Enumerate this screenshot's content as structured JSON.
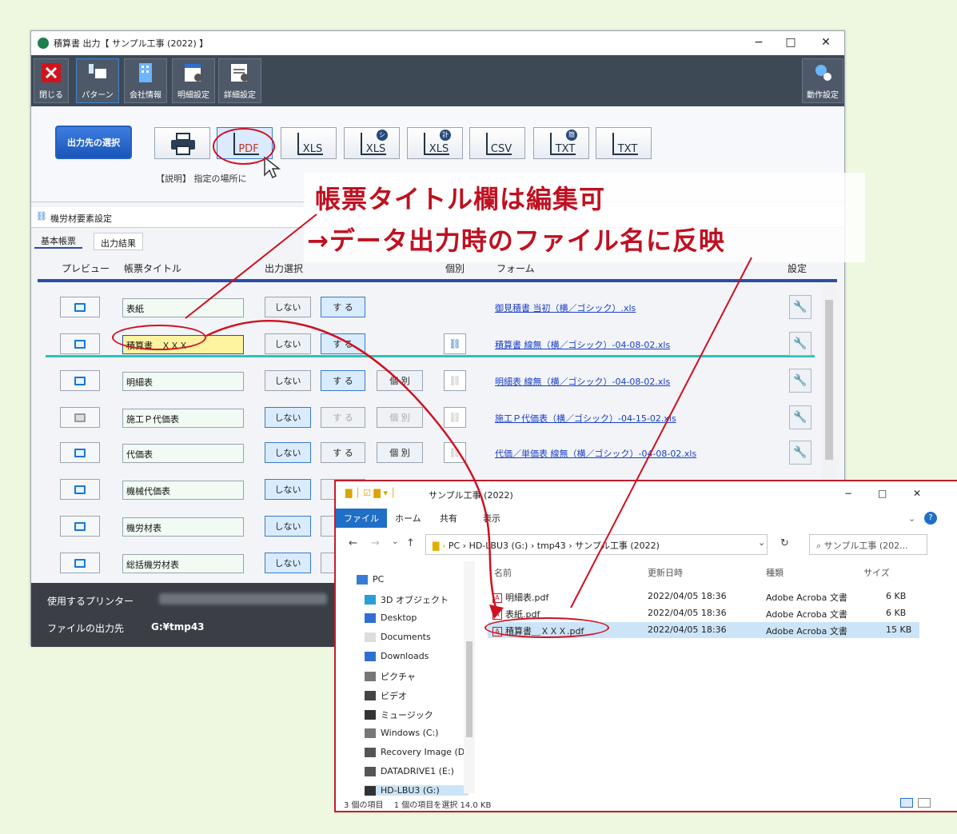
{
  "window": {
    "title": "積算書 出力【 サンプル工事 (2022) 】",
    "minimize": "−",
    "maximize": "□",
    "close": "✕"
  },
  "ribbon": {
    "items": [
      {
        "label": "閉じる",
        "icon": "close-icon"
      },
      {
        "label": "パターン",
        "icon": "pattern-icon"
      },
      {
        "label": "会社情報",
        "icon": "company-icon"
      },
      {
        "label": "明細設定",
        "icon": "detail-settings-icon"
      },
      {
        "label": "詳細設定",
        "icon": "advanced-settings-icon"
      },
      {
        "label": "動作設定",
        "icon": "behavior-settings-icon"
      }
    ]
  },
  "toolbar": {
    "select_label": "出力先の選択",
    "formats": [
      "PDF",
      "XLS",
      "XLS",
      "XLS",
      "CSV",
      "TXT",
      "TXT"
    ],
    "format_badges": [
      "",
      "",
      "シ",
      "計",
      "",
      "簡",
      ""
    ],
    "description": "【説明】 指定の場所に"
  },
  "panel": {
    "title": "機労材要素設定",
    "tabs": [
      "基本帳票",
      "出力結果"
    ],
    "headers": {
      "preview": "プレビュー",
      "title": "帳票タイトル",
      "output": "出力選択",
      "individual": "個別",
      "form": "フォーム",
      "settings": "設定"
    }
  },
  "rows": [
    {
      "title": "表紙",
      "no": "しない",
      "yes": "す る",
      "ind": "",
      "form": "御見積書 当初（横／ゴシック）.xls",
      "state": "yes",
      "prev": true,
      "kobetsu": false
    },
    {
      "title": "積算書＿ＸＸＸ",
      "no": "しない",
      "yes": "す る",
      "ind": "",
      "form": "積算書 線無（横／ゴシック）-04-08-02.xls",
      "state": "yes",
      "prev": true,
      "kobetsu": true
    },
    {
      "title": "明細表",
      "no": "しない",
      "yes": "す る",
      "ind": "個 別",
      "form": "明細表 線無（横／ゴシック）-04-08-02.xls",
      "state": "yes",
      "prev": true,
      "kobetsu": true
    },
    {
      "title": "施工Ｐ代価表",
      "no": "しない",
      "yes": "す る",
      "ind": "個 別",
      "form": "施工Ｐ代価表（横／ゴシック）-04-15-02.xls",
      "state": "no",
      "prev": false,
      "kobetsu": true
    },
    {
      "title": "代価表",
      "no": "しない",
      "yes": "す る",
      "ind": "個 別",
      "form": "代価／単価表 線無（横／ゴシック）-04-08-02.xls",
      "state": "no",
      "prev": true,
      "kobetsu": true
    },
    {
      "title": "機械代価表",
      "no": "しない",
      "yes": "す",
      "ind": "",
      "form": "",
      "state": "no",
      "prev": true,
      "kobetsu": false
    },
    {
      "title": "機労材表",
      "no": "しない",
      "yes": "す",
      "ind": "",
      "form": "",
      "state": "no",
      "prev": true,
      "kobetsu": false
    },
    {
      "title": "総括機労材表",
      "no": "しない",
      "yes": "す",
      "ind": "",
      "form": "",
      "state": "no",
      "prev": true,
      "kobetsu": false
    }
  ],
  "bottom": {
    "printer_label": "使用するプリンター",
    "output_label": "ファイルの出力先",
    "output_value": "G:¥tmp43"
  },
  "explorer": {
    "title": "サンプル工事 (2022)",
    "tabs": [
      "ファイル",
      "ホーム",
      "共有",
      "表示"
    ],
    "path": [
      "PC",
      "HD-LBU3 (G:)",
      "tmp43",
      "サンプル工事 (2022)"
    ],
    "search_placeholder": "サンプル工事 (202...",
    "nav": [
      {
        "label": "PC",
        "icon": "pc-icon"
      },
      {
        "label": "3D オブジェクト",
        "icon": "3d-objects-icon"
      },
      {
        "label": "Desktop",
        "icon": "desktop-icon"
      },
      {
        "label": "Documents",
        "icon": "documents-icon"
      },
      {
        "label": "Downloads",
        "icon": "downloads-icon"
      },
      {
        "label": "ピクチャ",
        "icon": "pictures-icon"
      },
      {
        "label": "ビデオ",
        "icon": "videos-icon"
      },
      {
        "label": "ミュージック",
        "icon": "music-icon"
      },
      {
        "label": "Windows (C:)",
        "icon": "drive-icon"
      },
      {
        "label": "Recovery Image (D",
        "icon": "drive-icon"
      },
      {
        "label": "DATADRIVE1 (E:)",
        "icon": "drive-icon"
      },
      {
        "label": "HD-LBU3 (G:)",
        "icon": "drive-icon"
      }
    ],
    "columns": [
      "名前",
      "更新日時",
      "種類",
      "サイズ"
    ],
    "files": [
      {
        "name": "明細表.pdf",
        "date": "2022/04/05 18:36",
        "type": "Adobe Acroba 文書",
        "size": "6 KB"
      },
      {
        "name": "表紙.pdf",
        "date": "2022/04/05 18:36",
        "type": "Adobe Acroba 文書",
        "size": "6 KB"
      },
      {
        "name": "積算書＿ＸＸＸ.pdf",
        "date": "2022/04/05 18:36",
        "type": "Adobe Acroba 文書",
        "size": "15 KB"
      }
    ],
    "status": "3 個の項目　 1 個の項目を選択 14.0 KB"
  },
  "annotation": {
    "line1": "帳票タイトル欄は編集可",
    "line2": "→データ出力時のファイル名に反映"
  },
  "colors": {
    "accent": "#c01020",
    "ribbon": "#3e4956",
    "teal": "#2fc0b8",
    "blue": "#2d4ba8"
  }
}
